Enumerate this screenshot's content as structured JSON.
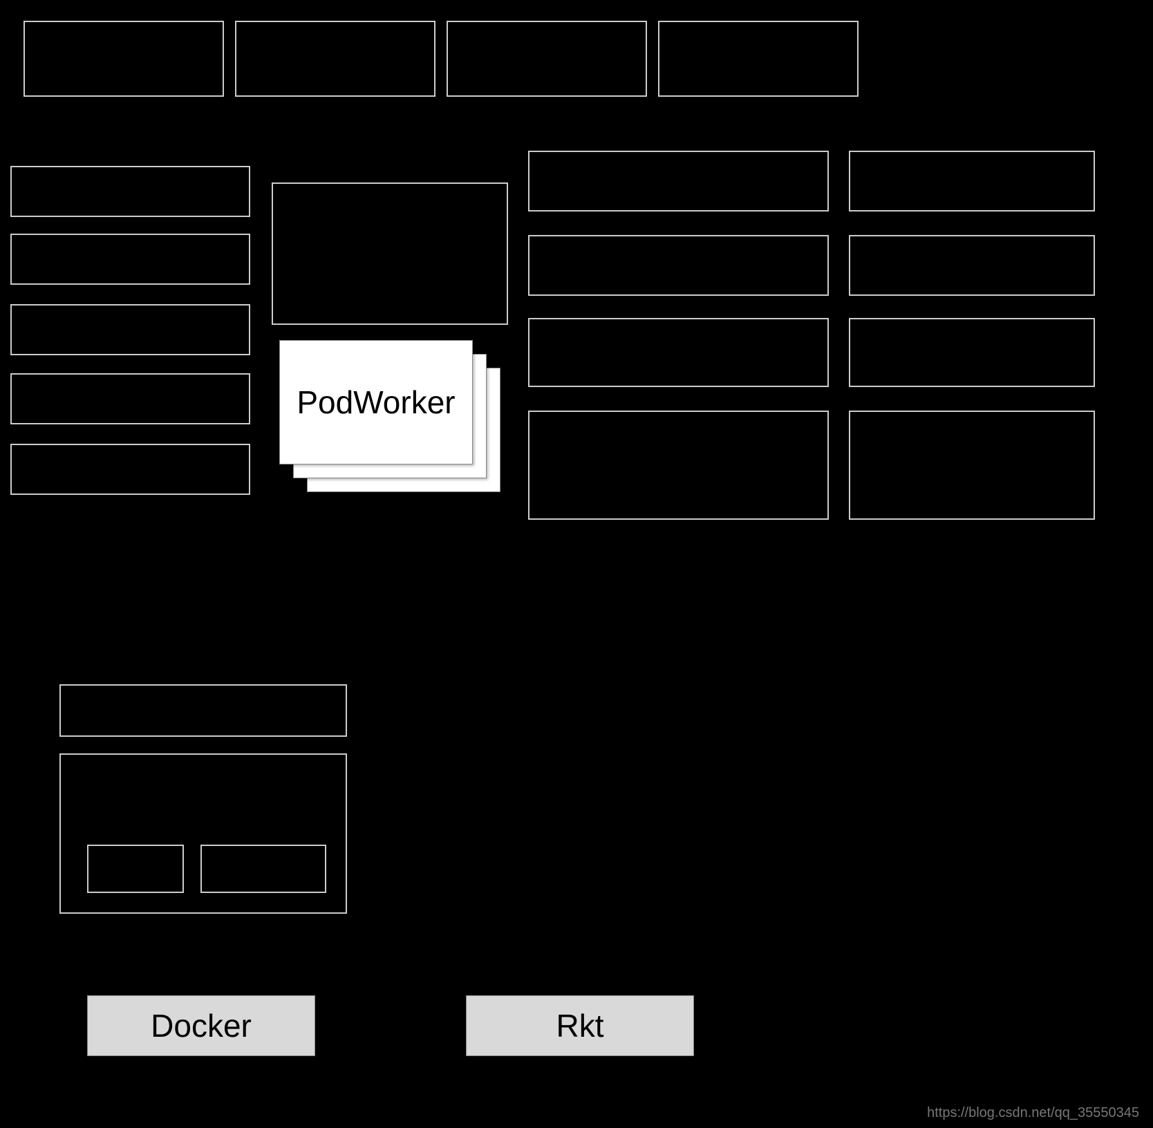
{
  "labels": {
    "podworker": "PodWorker",
    "docker": "Docker",
    "rkt": "Rkt",
    "watermark": "https://blog.csdn.net/qq_35550345"
  }
}
